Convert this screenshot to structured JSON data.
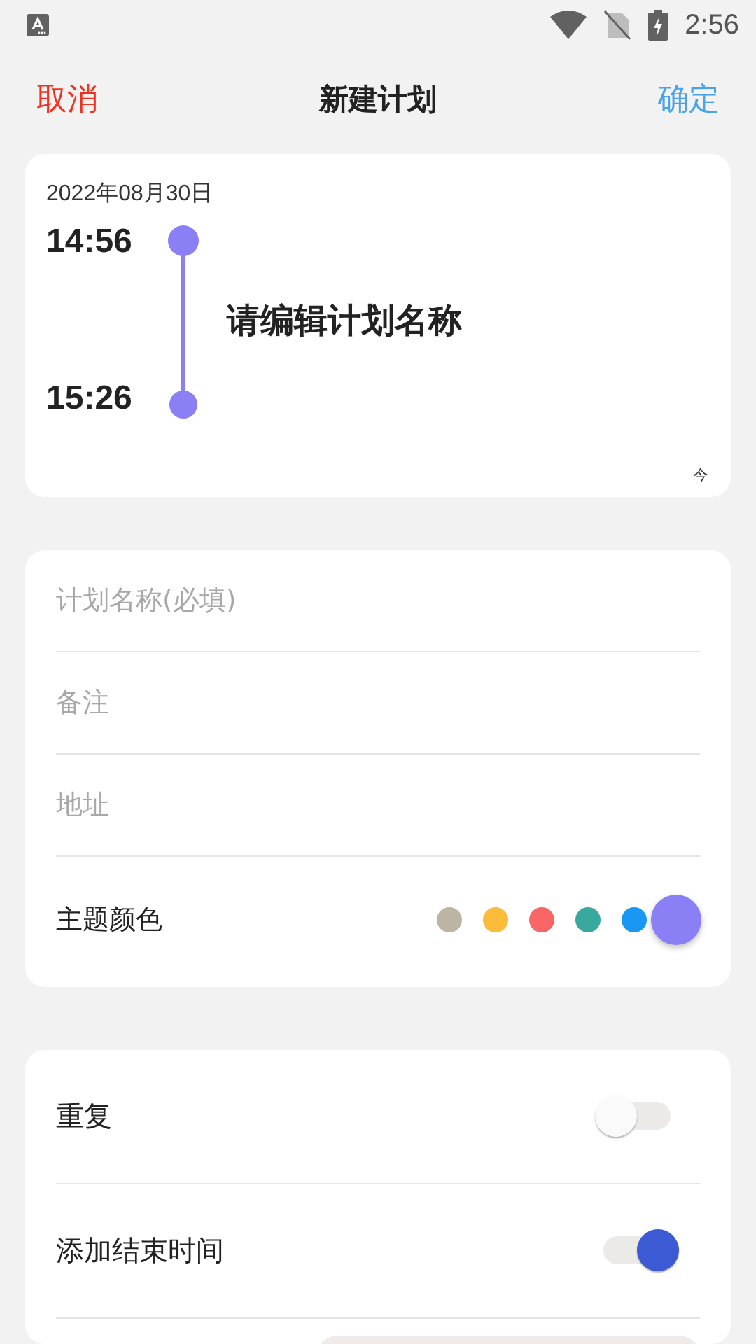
{
  "status_bar": {
    "time": "2:56"
  },
  "header": {
    "cancel": "取消",
    "title": "新建计划",
    "confirm": "确定"
  },
  "preview": {
    "date": "2022年08月30日",
    "start_time": "14:56",
    "end_time": "15:26",
    "name": "请编辑计划名称",
    "badge": "今",
    "color": "#8a7ff5"
  },
  "form": {
    "fields": [
      {
        "placeholder": "计划名称(必填)"
      },
      {
        "placeholder": "备注"
      },
      {
        "placeholder": "地址"
      }
    ],
    "theme_label": "主题颜色",
    "colors": [
      {
        "color": "#bcb5a4",
        "selected": false
      },
      {
        "color": "#fbbc3b",
        "selected": false
      },
      {
        "color": "#fa6565",
        "selected": false
      },
      {
        "color": "#39a99f",
        "selected": false
      },
      {
        "color": "#1a97f5",
        "selected": false
      },
      {
        "color": "#8a7ff5",
        "selected": true
      }
    ]
  },
  "options": [
    {
      "label": "重复",
      "on": false
    },
    {
      "label": "添加结束时间",
      "on": true
    }
  ]
}
